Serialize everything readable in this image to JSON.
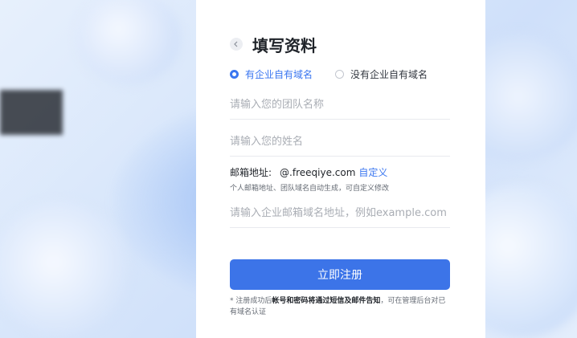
{
  "background": {
    "top_left_text": "",
    "bottom_left_text": ""
  },
  "header": {
    "back_icon": "chevron-left-icon",
    "title": "填写资料"
  },
  "domain_choice": {
    "option_has_domain": "有企业自有域名",
    "option_no_domain": "没有企业自有域名",
    "selected": "option_has_domain"
  },
  "form": {
    "team_name_placeholder": "请输入您的团队名称",
    "name_placeholder": "请输入您的姓名",
    "email_label": "邮箱地址:",
    "email_value": "@.freeqiye.com",
    "email_custom_link": "自定义",
    "email_hint": "个人邮箱地址、团队域名自动生成，可自定义修改",
    "domain_placeholder": "请输入企业邮箱域名地址，例如example.com"
  },
  "actions": {
    "submit_label": "立即注册"
  },
  "footnote": {
    "prefix": "* 注册成功后",
    "bold": "帐号和密码将通过短信及邮件告知",
    "suffix": "，可在管理后台对已有域名认证"
  },
  "colors": {
    "accent": "#3a76f0",
    "button": "#3c74e8"
  }
}
